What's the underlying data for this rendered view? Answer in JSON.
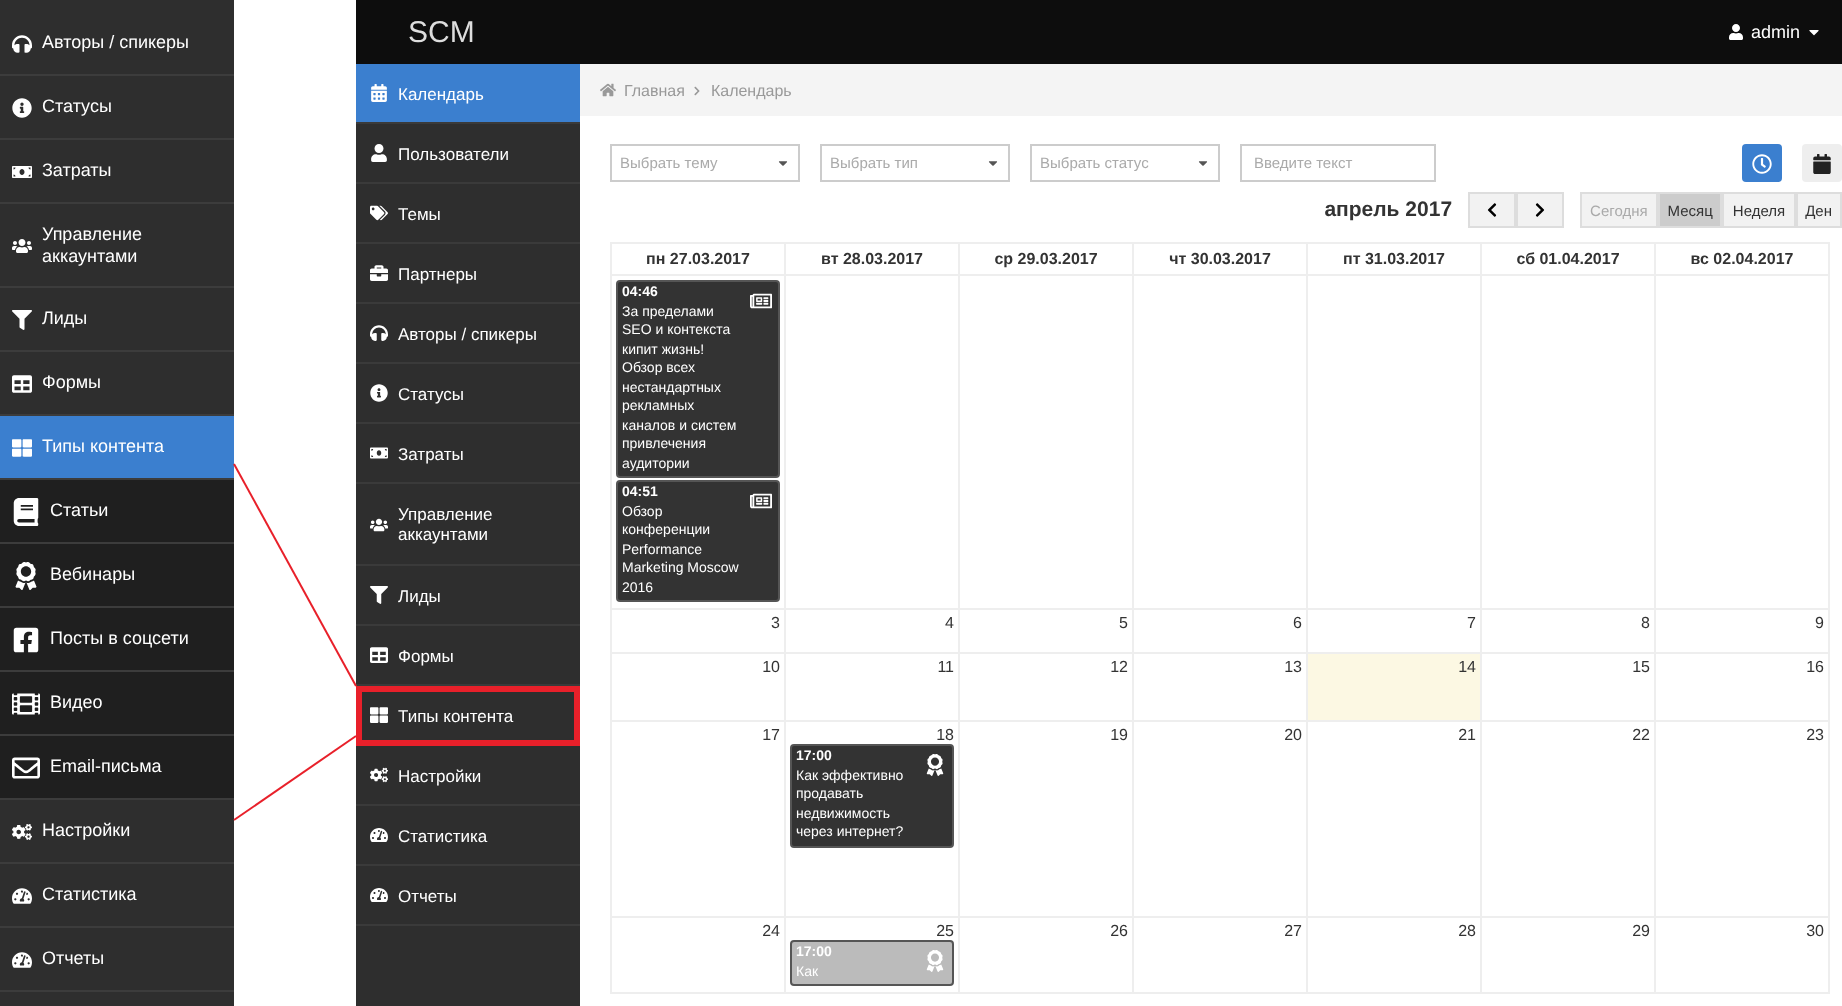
{
  "zoom_panel": {
    "items": [
      {
        "label": "Авторы / спикеры",
        "selected": false
      },
      {
        "label": "Статусы",
        "selected": false
      },
      {
        "label": "Затраты",
        "selected": false
      },
      {
        "label": "Управление аккаунтами",
        "selected": false
      },
      {
        "label": "Лиды",
        "selected": false
      },
      {
        "label": "Формы",
        "selected": false
      },
      {
        "label": "Типы контента",
        "selected": true,
        "expanded": true,
        "children": [
          {
            "label": "Статьи",
            "selected": false
          },
          {
            "label": "Вебинары",
            "selected": false
          },
          {
            "label": "Посты в соцсети",
            "selected": false
          },
          {
            "label": "Видео",
            "selected": false
          },
          {
            "label": "Email-письма",
            "selected": false
          }
        ]
      },
      {
        "label": "Настройки",
        "selected": false
      },
      {
        "label": "Статистика",
        "selected": false
      },
      {
        "label": "Отчеты",
        "selected": false
      }
    ]
  },
  "header": {
    "brand": "SCM",
    "user": "admin"
  },
  "sidebar": {
    "items": [
      {
        "label": "Календарь",
        "selected": true,
        "outlined": false
      },
      {
        "label": "Пользователи",
        "selected": false,
        "outlined": false
      },
      {
        "label": "Темы",
        "selected": false,
        "outlined": false
      },
      {
        "label": "Партнеры",
        "selected": false,
        "outlined": false
      },
      {
        "label": "Авторы / спикеры",
        "selected": false,
        "outlined": false
      },
      {
        "label": "Статусы",
        "selected": false,
        "outlined": false
      },
      {
        "label": "Затраты",
        "selected": false,
        "outlined": false
      },
      {
        "label": "Управление аккаунтами",
        "selected": false,
        "outlined": false
      },
      {
        "label": "Лиды",
        "selected": false,
        "outlined": false
      },
      {
        "label": "Формы",
        "selected": false,
        "outlined": false
      },
      {
        "label": "Типы контента",
        "selected": false,
        "outlined": true
      },
      {
        "label": "Настройки",
        "selected": false,
        "outlined": false
      },
      {
        "label": "Статистика",
        "selected": false,
        "outlined": false
      },
      {
        "label": "Отчеты",
        "selected": false,
        "outlined": false
      }
    ]
  },
  "breadcrumb": [
    "Главная",
    "Календарь"
  ],
  "filters": {
    "selects": [
      "Выбрать тему",
      "Выбрать тип",
      "Выбрать статус"
    ],
    "search": {
      "placeholder": "Введите текст"
    }
  },
  "calendar": {
    "title": "апрель 2017",
    "views": [
      {
        "label": "Сегодня",
        "selected": false,
        "disabled": true
      },
      {
        "label": "Месяц",
        "selected": true,
        "disabled": false
      },
      {
        "label": "Неделя",
        "selected": false,
        "disabled": false
      },
      {
        "label": "Ден",
        "selected": false,
        "disabled": false
      }
    ],
    "columns": [
      "пн 27.03.2017",
      "вт 28.03.2017",
      "ср 29.03.2017",
      "чт 30.03.2017",
      "пт 31.03.2017",
      "сб 01.04.2017",
      "вс 02.04.2017"
    ],
    "weeks": [
      {
        "days": [
          {
            "today": false,
            "events": [
              {
                "kind": "article",
                "faded": false,
                "time": "04:46",
                "title": "За пределами SEO и контекста кипит жизнь! Обзор всех нестандартных рекламных каналов и систем привлечения аудитории"
              },
              {
                "kind": "article",
                "faded": false,
                "time": "04:51",
                "title": "Обзор конференции Performance Marketing Moscow 2016"
              }
            ]
          },
          {
            "today": false
          },
          {
            "today": false
          },
          {
            "today": false
          },
          {
            "today": false
          },
          {
            "today": false
          },
          {
            "today": false
          }
        ]
      },
      {
        "days": [
          {
            "number": "3",
            "today": false
          },
          {
            "number": "4",
            "today": false
          },
          {
            "number": "5",
            "today": false
          },
          {
            "number": "6",
            "today": false
          },
          {
            "number": "7",
            "today": false
          },
          {
            "number": "8",
            "today": false
          },
          {
            "number": "9",
            "today": false
          }
        ]
      },
      {
        "days": [
          {
            "number": "10",
            "today": false
          },
          {
            "number": "11",
            "today": false
          },
          {
            "number": "12",
            "today": false
          },
          {
            "number": "13",
            "today": false
          },
          {
            "number": "14",
            "today": true
          },
          {
            "number": "15",
            "today": false
          },
          {
            "number": "16",
            "today": false
          }
        ]
      },
      {
        "days": [
          {
            "number": "17",
            "today": false
          },
          {
            "number": "18",
            "today": false,
            "events": [
              {
                "kind": "webinar",
                "faded": false,
                "time": "17:00",
                "title": "Как эффективно продавать недвижимость через интернет?"
              }
            ]
          },
          {
            "number": "19",
            "today": false
          },
          {
            "number": "20",
            "today": false
          },
          {
            "number": "21",
            "today": false
          },
          {
            "number": "22",
            "today": false
          },
          {
            "number": "23",
            "today": false
          }
        ]
      },
      {
        "days": [
          {
            "number": "24",
            "today": false
          },
          {
            "number": "25",
            "today": false,
            "events": [
              {
                "kind": "webinar",
                "faded": true,
                "time": "17:00",
                "title": "Как"
              }
            ]
          },
          {
            "number": "26",
            "today": false
          },
          {
            "number": "27",
            "today": false
          },
          {
            "number": "28",
            "today": false
          },
          {
            "number": "29",
            "today": false
          },
          {
            "number": "30",
            "today": false
          }
        ]
      }
    ]
  }
}
